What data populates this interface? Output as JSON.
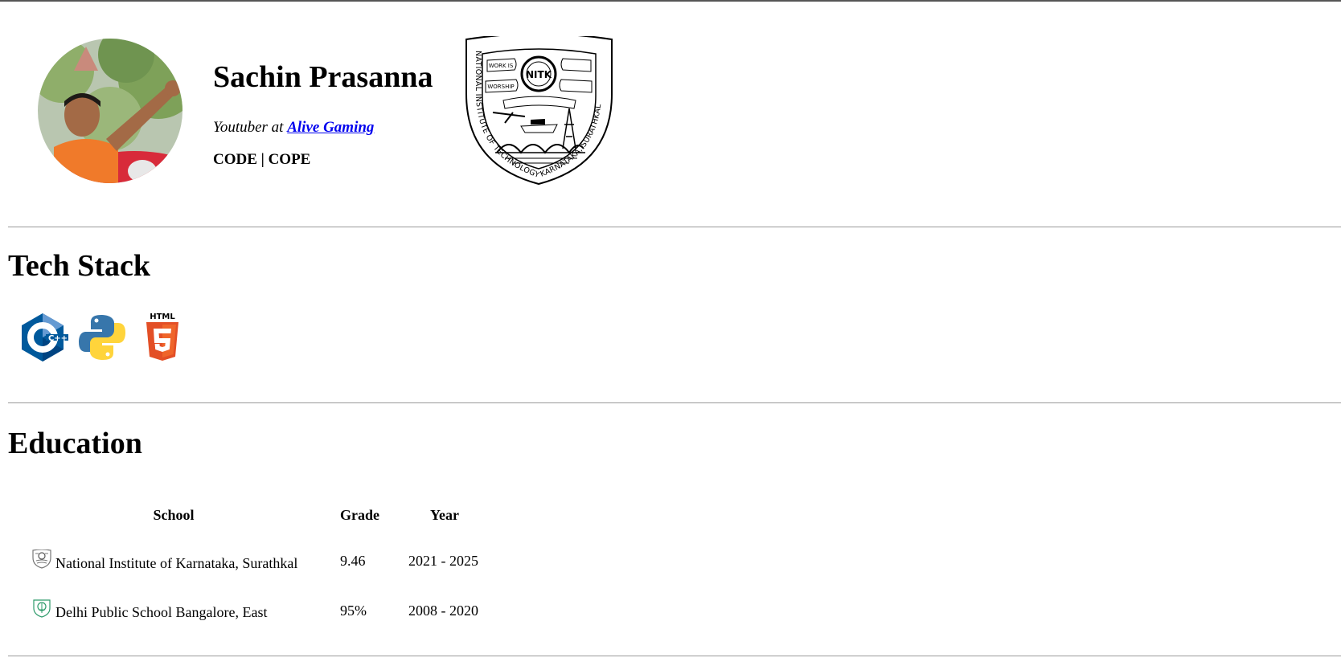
{
  "profile": {
    "name": "Sachin Prasanna",
    "tagline_prefix": "Youtuber at ",
    "tagline_link": "Alive Gaming",
    "motto": "CODE | COPE"
  },
  "crest": {
    "arc_text": "NATIONAL INSTITUTE OF TECHNOLOGY KARNATAKA, SURATHKAL",
    "banner_left_top": "WORK IS",
    "banner_left_bottom": "WORSHIP",
    "emblem_text": "NITK"
  },
  "tech_stack": {
    "heading": "Tech Stack",
    "items": [
      {
        "icon": "cplusplus-icon",
        "label": "C++"
      },
      {
        "icon": "python-icon"
      },
      {
        "icon": "html5-icon",
        "label": "HTML"
      }
    ]
  },
  "education": {
    "heading": "Education",
    "columns": [
      "School",
      "Grade",
      "Year"
    ],
    "rows": [
      {
        "logo": "nitk-logo-icon",
        "school": "National Institute of Karnataka, Surathkal",
        "grade": "9.46",
        "year": "2021 - 2025"
      },
      {
        "logo": "dps-logo-icon",
        "school": "Delhi Public School Bangalore, East",
        "grade": "95%",
        "year": "2008 - 2020"
      }
    ]
  },
  "colors": {
    "link": "#0000ee",
    "rule": "#999999",
    "cpp_blue": "#00599c",
    "python_blue": "#3776ab",
    "python_yellow": "#ffd43b",
    "html_orange": "#e34f26"
  }
}
